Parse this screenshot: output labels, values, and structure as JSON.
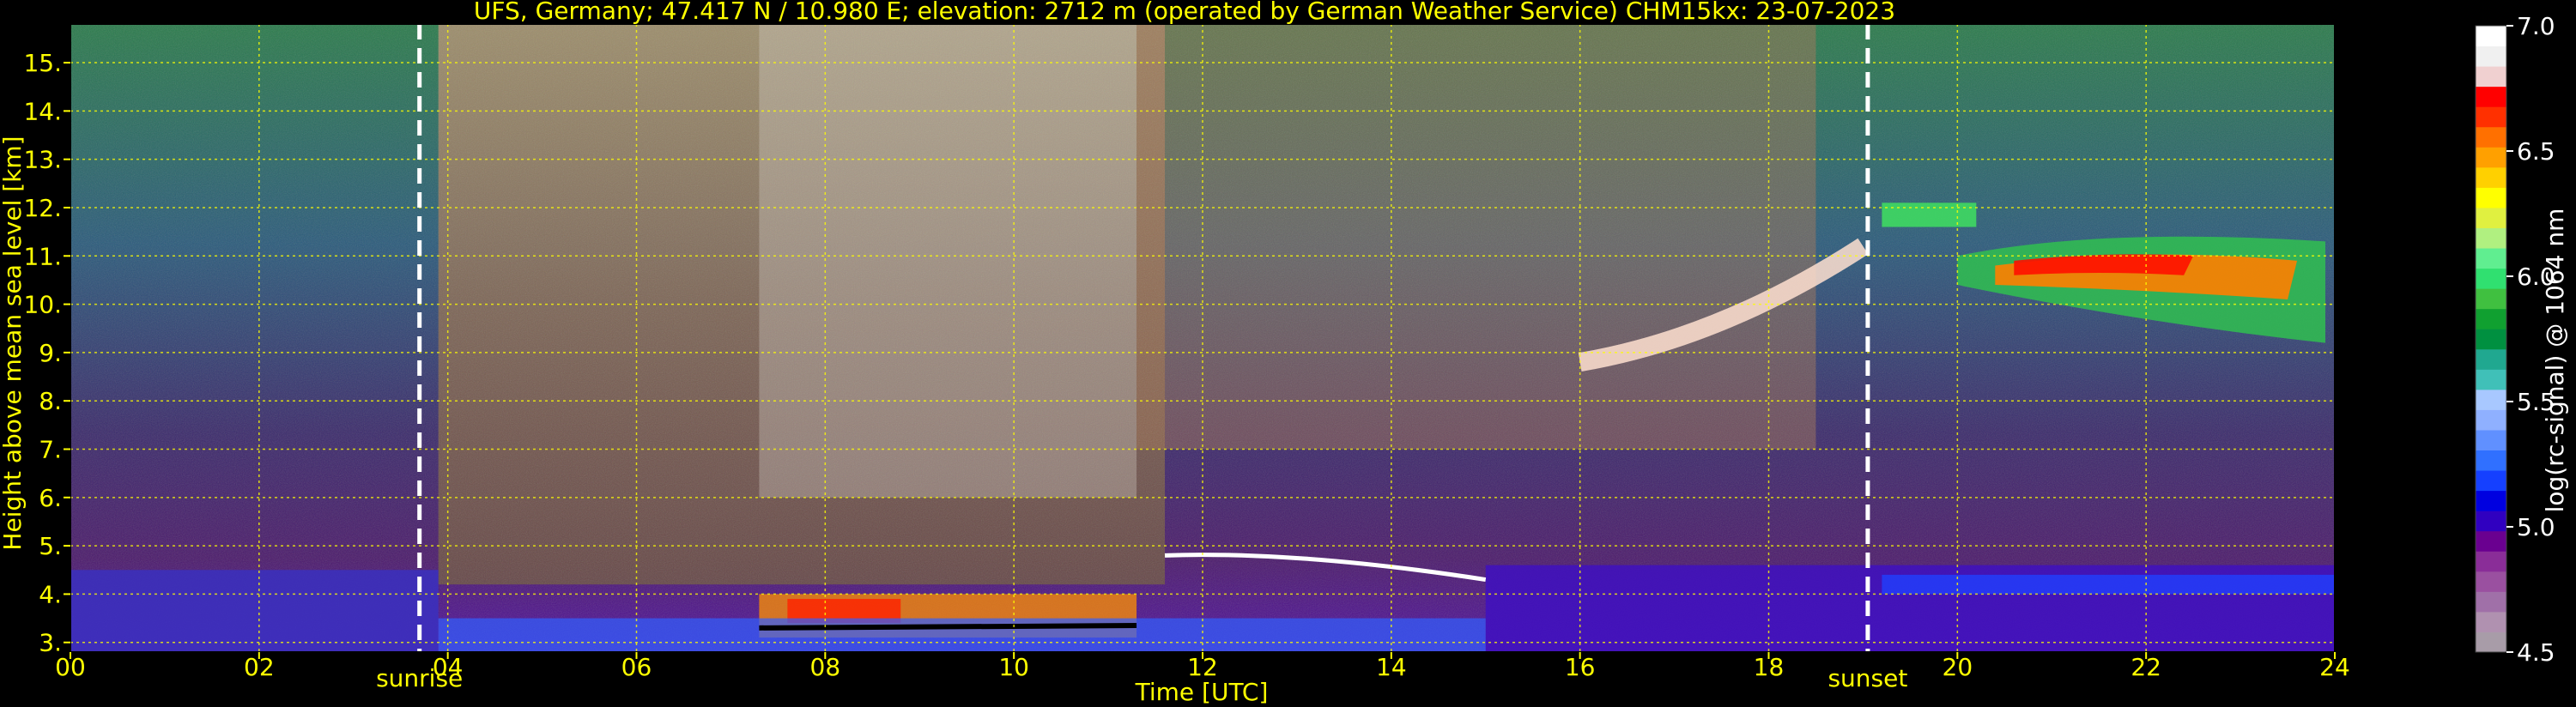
{
  "chart_data": {
    "type": "heatmap",
    "title": "UFS, Germany; 47.417 N / 10.980 E; elevation: 2712 m  (operated by German Weather Service)     CHM15kx: 23-07-2023",
    "xlabel": "Time [UTC]",
    "ylabel": "Height above mean sea level [km]",
    "xlim": [
      0,
      24
    ],
    "ylim": [
      2.8,
      15.8
    ],
    "x_ticks": [
      "00",
      "02",
      "04",
      "06",
      "08",
      "10",
      "12",
      "14",
      "16",
      "18",
      "20",
      "22",
      "24"
    ],
    "y_ticks": [
      "3.",
      "4.",
      "5.",
      "6.",
      "7.",
      "8.",
      "9.",
      "10.",
      "11.",
      "12.",
      "13.",
      "14.",
      "15."
    ],
    "grid": true,
    "markers": [
      {
        "label": "sunrise",
        "x": 3.7
      },
      {
        "label": "sunset",
        "x": 19.05
      }
    ],
    "colorbar": {
      "label": "log(rc-signal) @ 1064 nm",
      "range": [
        4.5,
        7.0
      ],
      "ticks": [
        "4.5",
        "5.0",
        "5.5",
        "6.0",
        "6.5",
        "7.0"
      ],
      "colors": [
        "#a89ca8",
        "#b091b0",
        "#a070a8",
        "#9a50a0",
        "#8a2d98",
        "#6a0090",
        "#3000c0",
        "#0000e0",
        "#1540ff",
        "#3070ff",
        "#6090ff",
        "#8fb0ff",
        "#a8c8ff",
        "#40c0b8",
        "#20a890",
        "#009040",
        "#10a030",
        "#40c040",
        "#30e070",
        "#60ee90",
        "#b0f080",
        "#e0f040",
        "#ffff00",
        "#ffd000",
        "#ffa000",
        "#ff7000",
        "#ff3000",
        "#ff0000",
        "#f0d0d0",
        "#f0f0f0",
        "#ffffff"
      ]
    },
    "features": [
      {
        "name": "high-cirrus",
        "x_start": 17.5,
        "x_end": 23.9,
        "y_center": 10.6
      },
      {
        "name": "boundary-layer",
        "x_start": 7.3,
        "x_end": 11.3,
        "y_center": 3.5
      },
      {
        "name": "noise-region",
        "x_start": 3.9,
        "x_end": 11.6,
        "y_center": 10.0
      }
    ]
  },
  "colors": {
    "text": "#ffff00",
    "grid": "#ffff00",
    "marker": "#ffffff"
  }
}
